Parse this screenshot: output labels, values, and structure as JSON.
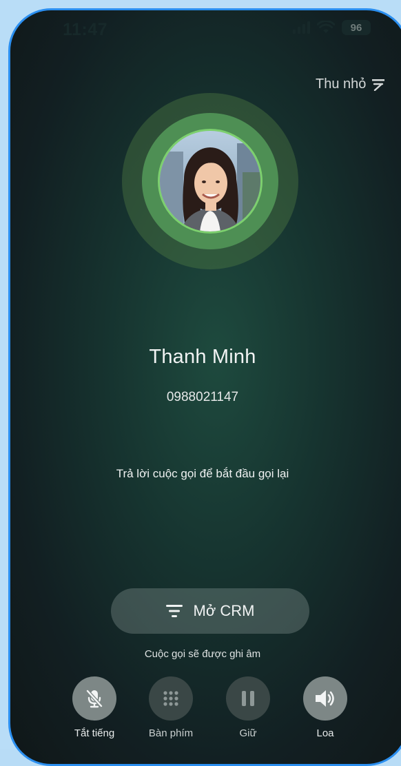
{
  "status_bar": {
    "time": "11:47",
    "battery": "96",
    "icons": [
      "signal-icon",
      "wifi-icon",
      "battery-icon"
    ]
  },
  "header": {
    "minimize_label": "Thu nhỏ",
    "minimize_icon": "arrow-up-to-line-icon"
  },
  "caller": {
    "name": "Thanh Minh",
    "number": "0988021147",
    "avatar": "caller-photo"
  },
  "call": {
    "hint": "Trả lời cuộc gọi để bắt đầu gọi lại",
    "crm_button_label": "Mở CRM",
    "crm_icon": "filter-icon",
    "record_note": "Cuộc gọi sẽ được ghi âm"
  },
  "controls": [
    {
      "label": "Tắt tiếng",
      "icon": "mic-off-icon"
    },
    {
      "label": "Bàn phím",
      "icon": "keypad-icon"
    },
    {
      "label": "Giữ",
      "icon": "pause-icon"
    },
    {
      "label": "Loa",
      "icon": "speaker-icon"
    }
  ],
  "colors": {
    "frame_border": "#2b8ff0",
    "page_background": "#b9ddf7",
    "avatar_ring": "#4e8f54",
    "avatar_border": "#7dd06e",
    "screen_background": "#16332f"
  }
}
